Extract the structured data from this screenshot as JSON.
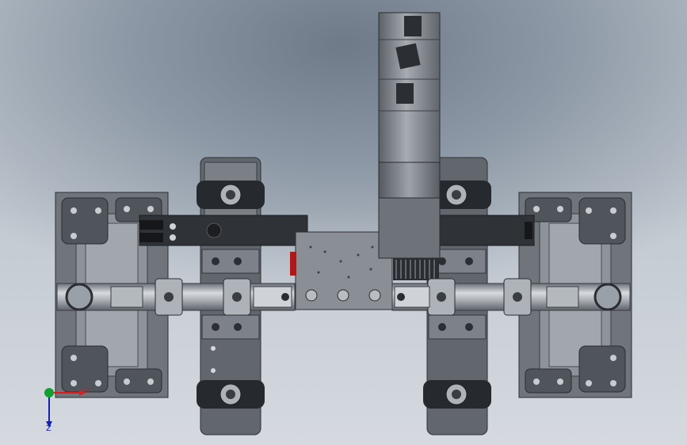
{
  "viewport": {
    "background": "#8a96a3"
  },
  "triad": {
    "x_label": "Y",
    "y_label": "Z",
    "colors": {
      "red": "#d42020",
      "blue": "#1020c0",
      "green": "#10a030"
    }
  },
  "colors": {
    "frame": "#5b6068",
    "frame_dark": "#33363b",
    "metal": "#9aa0a7",
    "metal_light": "#cfd3d8",
    "wheel": "#22252a",
    "motor": "#8a8f96",
    "accent_red": "#b01818"
  }
}
